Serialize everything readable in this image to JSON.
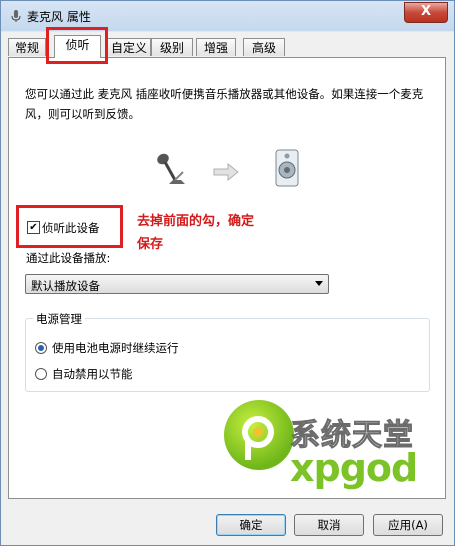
{
  "window": {
    "title": "麦克风 属性",
    "close_label": "X"
  },
  "tabs": [
    {
      "label": "常规"
    },
    {
      "label": "侦听"
    },
    {
      "label": "自定义"
    },
    {
      "label": "级别"
    },
    {
      "label": "增强"
    },
    {
      "label": "高级"
    }
  ],
  "listen": {
    "description": "您可以通过此 麦克风 插座收听便携音乐播放器或其他设备。如果连接一个麦克风，则可以听到反馈。",
    "listen_checkbox_label": "侦听此设备",
    "listen_checked": true,
    "playback_label": "通过此设备播放:",
    "playback_device": "默认播放设备"
  },
  "annotation": {
    "line1": "去掉前面的勾，确定",
    "line2": "保存"
  },
  "power": {
    "group_title": "电源管理",
    "option1": "使用电池电源时继续运行",
    "option2": "自动禁用以节能",
    "selected": "option1"
  },
  "buttons": {
    "ok": "确定",
    "cancel": "取消",
    "apply": "应用(A)"
  },
  "watermark": {
    "line1": "系统天堂",
    "line2": "xpgod"
  },
  "colors": {
    "highlight_red": "#e02020",
    "logo_green": "#7bc326"
  }
}
